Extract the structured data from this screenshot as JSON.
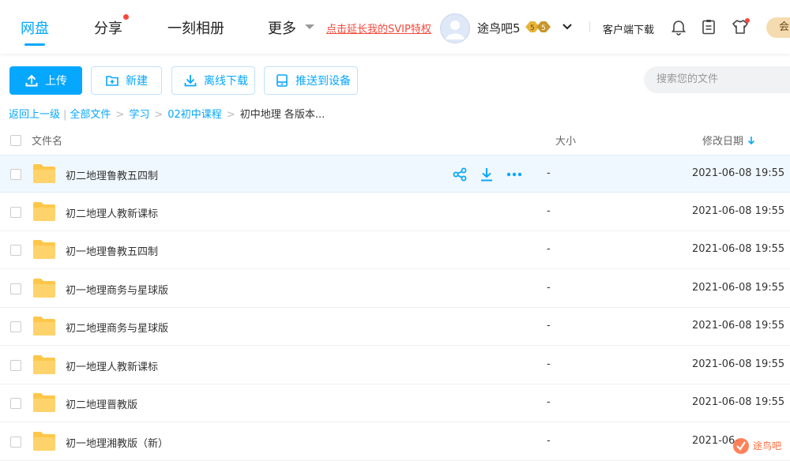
{
  "nav": {
    "items": [
      "网盘",
      "分享",
      "一刻相册",
      "更多"
    ],
    "svip_link": "点击延长我的SVIP特权",
    "username": "途鸟吧5",
    "level": "5",
    "client_download": "客户端下载",
    "member_label": "会"
  },
  "toolbar": {
    "upload": "上传",
    "new": "新建",
    "offline_download": "离线下载",
    "push_to_device": "推送到设备",
    "search_placeholder": "搜索您的文件"
  },
  "breadcrumb": {
    "back": "返回上一级",
    "items": [
      "全部文件",
      "学习",
      "02初中课程"
    ],
    "current": "初中地理 各版本..."
  },
  "table": {
    "headers": {
      "name": "文件名",
      "size": "大小",
      "modified": "修改日期"
    },
    "rows": [
      {
        "name": "初二地理鲁教五四制",
        "size": "-",
        "modified": "2021-06-08 19:55"
      },
      {
        "name": "初二地理人教新课标",
        "size": "-",
        "modified": "2021-06-08 19:55"
      },
      {
        "name": "初一地理鲁教五四制",
        "size": "-",
        "modified": "2021-06-08 19:55"
      },
      {
        "name": "初一地理商务与星球版",
        "size": "-",
        "modified": "2021-06-08 19:55"
      },
      {
        "name": "初二地理商务与星球版",
        "size": "-",
        "modified": "2021-06-08 19:55"
      },
      {
        "name": "初一地理人教新课标",
        "size": "-",
        "modified": "2021-06-08 19:55"
      },
      {
        "name": "初二地理晋教版",
        "size": "-",
        "modified": "2021-06-08 19:55"
      },
      {
        "name": "初一地理湘教版（新）",
        "size": "-",
        "modified": "2021-06-"
      }
    ]
  },
  "watermark": "途鸟吧",
  "colors": {
    "accent": "#06a7ff",
    "alert": "#f5483b",
    "folder": "#ffc74a"
  }
}
